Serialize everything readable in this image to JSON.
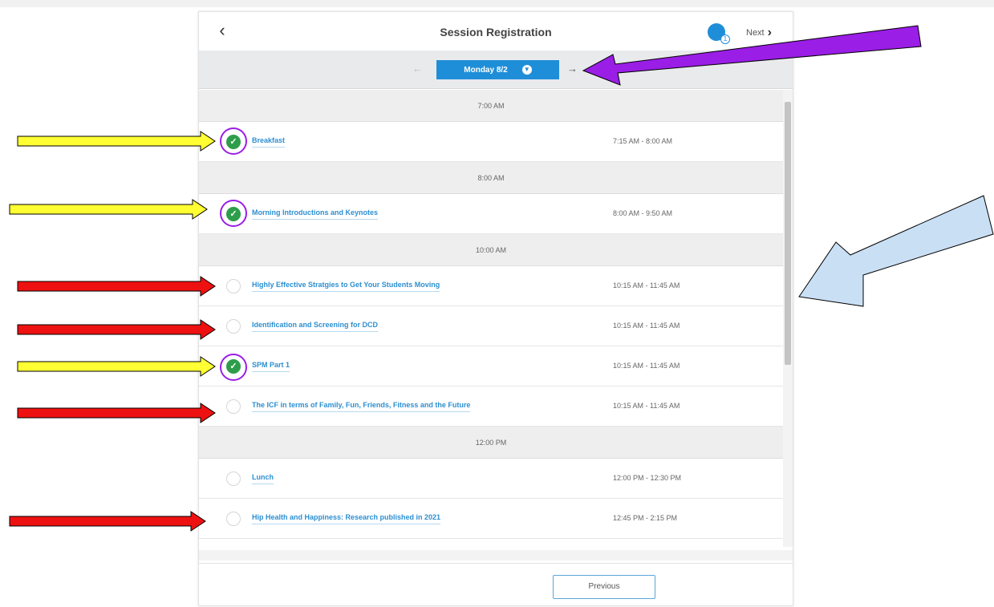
{
  "header": {
    "title": "Session Registration",
    "next_label": "Next",
    "cart_count": "1"
  },
  "day_nav": {
    "selected_day": "Monday 8/2"
  },
  "timeslots": [
    {
      "label": "7:00 AM",
      "sessions": [
        {
          "name": "Breakfast",
          "time": "7:15 AM - 8:00 AM",
          "selected": true
        }
      ]
    },
    {
      "label": "8:00 AM",
      "sessions": [
        {
          "name": "Morning Introductions and Keynotes",
          "time": "8:00 AM - 9:50 AM",
          "selected": true
        }
      ]
    },
    {
      "label": "10:00 AM",
      "sessions": [
        {
          "name": "Highly Effective Stratgies to Get Your Students Moving",
          "time": "10:15 AM - 11:45 AM",
          "selected": false
        },
        {
          "name": "Identification and Screening for DCD",
          "time": "10:15 AM - 11:45 AM",
          "selected": false
        },
        {
          "name": "SPM Part 1",
          "time": "10:15 AM - 11:45 AM",
          "selected": true
        },
        {
          "name": "The ICF in terms of Family, Fun, Friends, Fitness and the Future",
          "time": "10:15 AM - 11:45 AM",
          "selected": false
        }
      ]
    },
    {
      "label": "12:00 PM",
      "sessions": [
        {
          "name": "Lunch",
          "time": "12:00 PM - 12:30 PM",
          "selected": false
        },
        {
          "name": "Hip Health and Happiness: Research published in 2021",
          "time": "12:45 PM - 2:15 PM",
          "selected": false
        }
      ]
    }
  ],
  "footer": {
    "previous_label": "Previous"
  },
  "colors": {
    "accent": "#1f8ed8",
    "selected_check": "#2e9d4a",
    "annotation_yellow": "#ffff33",
    "annotation_red": "#ee1111",
    "annotation_purple": "#9a1ee6",
    "annotation_lightblue": "#c9dff4"
  }
}
